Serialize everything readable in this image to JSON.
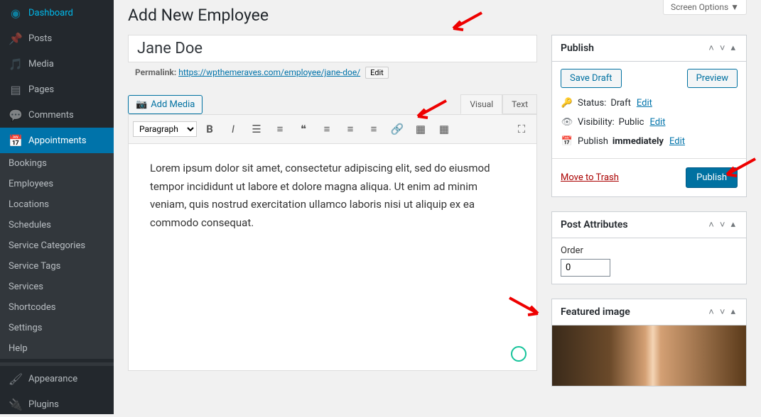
{
  "sidebar": {
    "items": [
      {
        "label": "Dashboard",
        "icon": "◷"
      },
      {
        "label": "Posts",
        "icon": "✎"
      },
      {
        "label": "Media",
        "icon": "🖼"
      },
      {
        "label": "Pages",
        "icon": "▤"
      },
      {
        "label": "Comments",
        "icon": "💬"
      },
      {
        "label": "Appointments",
        "icon": "📅"
      }
    ],
    "submenu": [
      {
        "label": "Bookings"
      },
      {
        "label": "Employees"
      },
      {
        "label": "Locations"
      },
      {
        "label": "Schedules"
      },
      {
        "label": "Service Categories"
      },
      {
        "label": "Service Tags"
      },
      {
        "label": "Services"
      },
      {
        "label": "Shortcodes"
      },
      {
        "label": "Settings"
      },
      {
        "label": "Help"
      }
    ],
    "bottom": [
      {
        "label": "Appearance",
        "icon": "✎"
      },
      {
        "label": "Plugins",
        "icon": "◆"
      }
    ]
  },
  "screen_options": "Screen Options ▼",
  "page_title": "Add New Employee",
  "title_value": "Jane Doe",
  "permalink": {
    "label": "Permalink:",
    "url": "https://wpthemeraves.com/employee/jane-doe/",
    "edit": "Edit"
  },
  "add_media": "Add Media",
  "editor_tabs": {
    "visual": "Visual",
    "text": "Text"
  },
  "format_select": "Paragraph",
  "editor_content": "Lorem ipsum dolor sit amet, consectetur adipiscing elit, sed do eiusmod tempor incididunt ut labore et dolore magna aliqua. Ut enim ad minim veniam, quis nostrud exercitation ullamco laboris nisi ut aliquip ex ea commodo consequat.",
  "publish": {
    "title": "Publish",
    "save_draft": "Save Draft",
    "preview": "Preview",
    "status_label": "Status:",
    "status_value": "Draft",
    "status_edit": "Edit",
    "visibility_label": "Visibility:",
    "visibility_value": "Public",
    "visibility_edit": "Edit",
    "schedule_label": "Publish",
    "schedule_value": "immediately",
    "schedule_edit": "Edit",
    "trash": "Move to Trash",
    "submit": "Publish"
  },
  "post_attributes": {
    "title": "Post Attributes",
    "order_label": "Order",
    "order_value": "0"
  },
  "featured_image": {
    "title": "Featured image"
  }
}
